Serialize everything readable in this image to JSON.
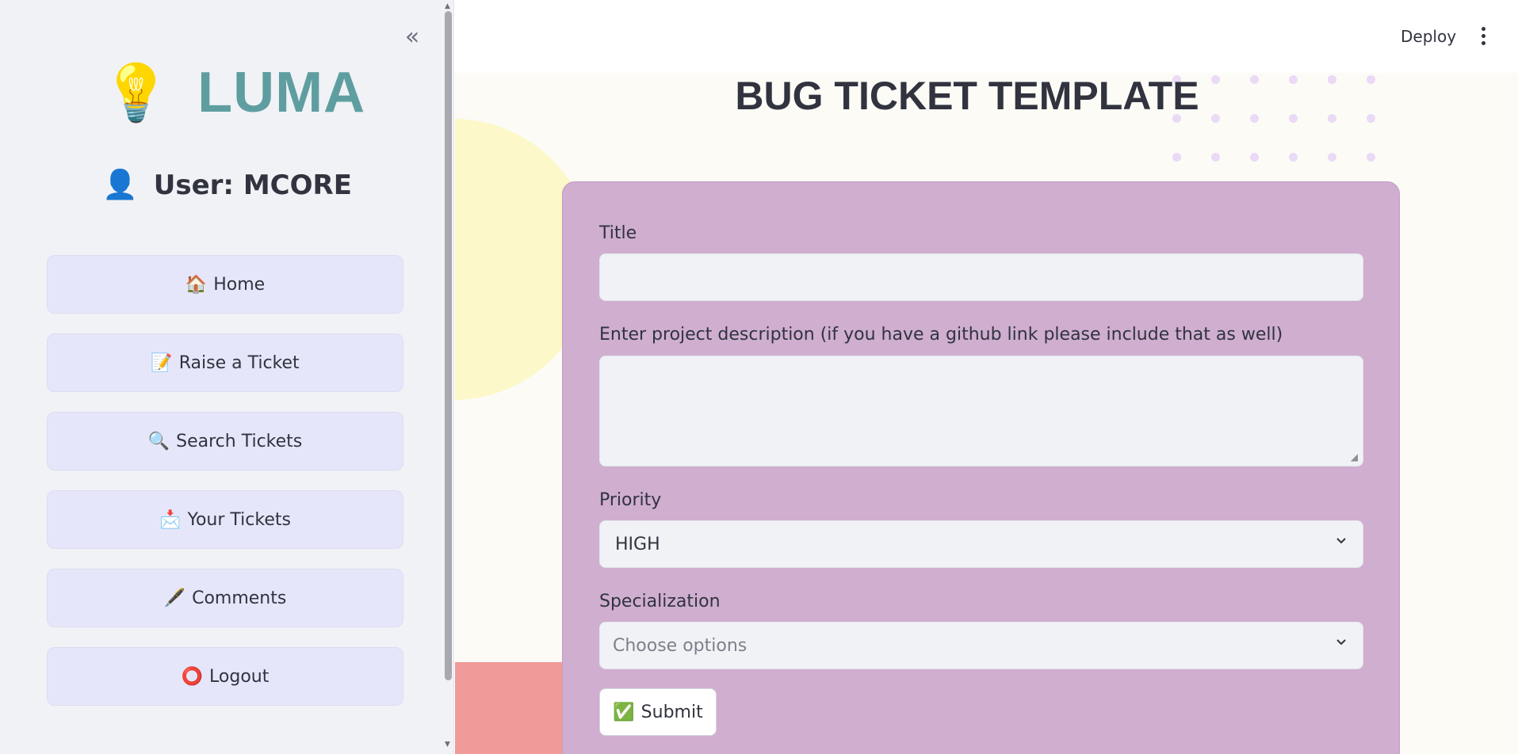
{
  "sidebar": {
    "collapse_icon": "«",
    "logo": {
      "bulb": "💡",
      "text": "LUMA"
    },
    "user": {
      "icon": "👤",
      "label": "User: MCORE"
    },
    "items": [
      {
        "icon": "🏠",
        "label": "Home"
      },
      {
        "icon": "📝",
        "label": "Raise a Ticket"
      },
      {
        "icon": "🔍",
        "label": "Search Tickets"
      },
      {
        "icon": "📩",
        "label": "Your Tickets"
      },
      {
        "icon": "🖋️",
        "label": "Comments"
      },
      {
        "icon": "⭕",
        "label": "Logout"
      }
    ]
  },
  "header": {
    "deploy_label": "Deploy"
  },
  "main": {
    "title": "BUG TICKET TEMPLATE",
    "form": {
      "title_label": "Title",
      "title_value": "",
      "description_label": "Enter project description (if you have a github link please include that as well)",
      "description_value": "",
      "priority_label": "Priority",
      "priority_value": "HIGH",
      "specialization_label": "Specialization",
      "specialization_placeholder": "Choose options",
      "submit_icon": "✅",
      "submit_label": "Submit"
    }
  },
  "colors": {
    "sidebar_bg": "#f0f2f6",
    "nav_button_bg": "#e6e6fa",
    "logo_text": "#5f9ea0",
    "form_card_bg": "#cfaed0",
    "decor_yellow": "#fdf8c9",
    "decor_pink": "#f09b99",
    "decor_dots": "#eadaf6"
  }
}
